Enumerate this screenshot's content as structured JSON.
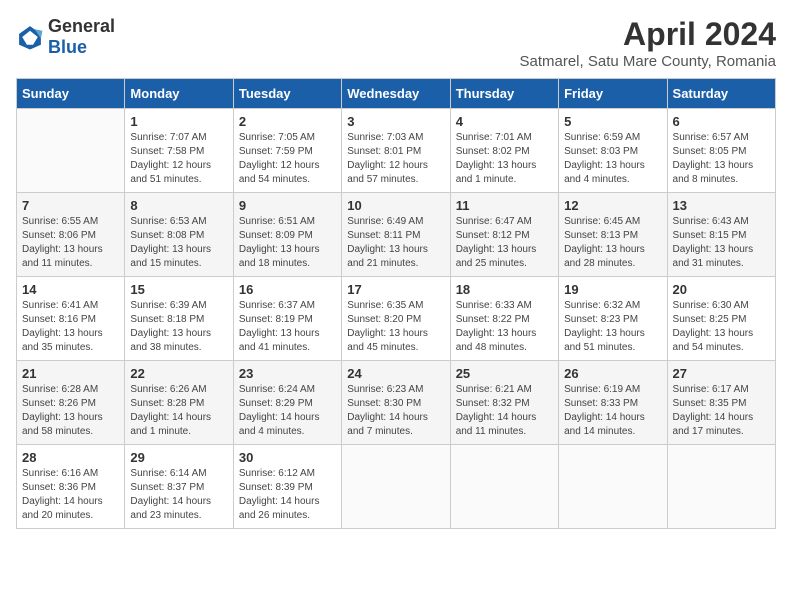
{
  "header": {
    "logo_general": "General",
    "logo_blue": "Blue",
    "month_title": "April 2024",
    "subtitle": "Satmarel, Satu Mare County, Romania"
  },
  "days_of_week": [
    "Sunday",
    "Monday",
    "Tuesday",
    "Wednesday",
    "Thursday",
    "Friday",
    "Saturday"
  ],
  "weeks": [
    [
      {
        "day": "",
        "sunrise": "",
        "sunset": "",
        "daylight": ""
      },
      {
        "day": "1",
        "sunrise": "Sunrise: 7:07 AM",
        "sunset": "Sunset: 7:58 PM",
        "daylight": "Daylight: 12 hours and 51 minutes."
      },
      {
        "day": "2",
        "sunrise": "Sunrise: 7:05 AM",
        "sunset": "Sunset: 7:59 PM",
        "daylight": "Daylight: 12 hours and 54 minutes."
      },
      {
        "day": "3",
        "sunrise": "Sunrise: 7:03 AM",
        "sunset": "Sunset: 8:01 PM",
        "daylight": "Daylight: 12 hours and 57 minutes."
      },
      {
        "day": "4",
        "sunrise": "Sunrise: 7:01 AM",
        "sunset": "Sunset: 8:02 PM",
        "daylight": "Daylight: 13 hours and 1 minute."
      },
      {
        "day": "5",
        "sunrise": "Sunrise: 6:59 AM",
        "sunset": "Sunset: 8:03 PM",
        "daylight": "Daylight: 13 hours and 4 minutes."
      },
      {
        "day": "6",
        "sunrise": "Sunrise: 6:57 AM",
        "sunset": "Sunset: 8:05 PM",
        "daylight": "Daylight: 13 hours and 8 minutes."
      }
    ],
    [
      {
        "day": "7",
        "sunrise": "Sunrise: 6:55 AM",
        "sunset": "Sunset: 8:06 PM",
        "daylight": "Daylight: 13 hours and 11 minutes."
      },
      {
        "day": "8",
        "sunrise": "Sunrise: 6:53 AM",
        "sunset": "Sunset: 8:08 PM",
        "daylight": "Daylight: 13 hours and 15 minutes."
      },
      {
        "day": "9",
        "sunrise": "Sunrise: 6:51 AM",
        "sunset": "Sunset: 8:09 PM",
        "daylight": "Daylight: 13 hours and 18 minutes."
      },
      {
        "day": "10",
        "sunrise": "Sunrise: 6:49 AM",
        "sunset": "Sunset: 8:11 PM",
        "daylight": "Daylight: 13 hours and 21 minutes."
      },
      {
        "day": "11",
        "sunrise": "Sunrise: 6:47 AM",
        "sunset": "Sunset: 8:12 PM",
        "daylight": "Daylight: 13 hours and 25 minutes."
      },
      {
        "day": "12",
        "sunrise": "Sunrise: 6:45 AM",
        "sunset": "Sunset: 8:13 PM",
        "daylight": "Daylight: 13 hours and 28 minutes."
      },
      {
        "day": "13",
        "sunrise": "Sunrise: 6:43 AM",
        "sunset": "Sunset: 8:15 PM",
        "daylight": "Daylight: 13 hours and 31 minutes."
      }
    ],
    [
      {
        "day": "14",
        "sunrise": "Sunrise: 6:41 AM",
        "sunset": "Sunset: 8:16 PM",
        "daylight": "Daylight: 13 hours and 35 minutes."
      },
      {
        "day": "15",
        "sunrise": "Sunrise: 6:39 AM",
        "sunset": "Sunset: 8:18 PM",
        "daylight": "Daylight: 13 hours and 38 minutes."
      },
      {
        "day": "16",
        "sunrise": "Sunrise: 6:37 AM",
        "sunset": "Sunset: 8:19 PM",
        "daylight": "Daylight: 13 hours and 41 minutes."
      },
      {
        "day": "17",
        "sunrise": "Sunrise: 6:35 AM",
        "sunset": "Sunset: 8:20 PM",
        "daylight": "Daylight: 13 hours and 45 minutes."
      },
      {
        "day": "18",
        "sunrise": "Sunrise: 6:33 AM",
        "sunset": "Sunset: 8:22 PM",
        "daylight": "Daylight: 13 hours and 48 minutes."
      },
      {
        "day": "19",
        "sunrise": "Sunrise: 6:32 AM",
        "sunset": "Sunset: 8:23 PM",
        "daylight": "Daylight: 13 hours and 51 minutes."
      },
      {
        "day": "20",
        "sunrise": "Sunrise: 6:30 AM",
        "sunset": "Sunset: 8:25 PM",
        "daylight": "Daylight: 13 hours and 54 minutes."
      }
    ],
    [
      {
        "day": "21",
        "sunrise": "Sunrise: 6:28 AM",
        "sunset": "Sunset: 8:26 PM",
        "daylight": "Daylight: 13 hours and 58 minutes."
      },
      {
        "day": "22",
        "sunrise": "Sunrise: 6:26 AM",
        "sunset": "Sunset: 8:28 PM",
        "daylight": "Daylight: 14 hours and 1 minute."
      },
      {
        "day": "23",
        "sunrise": "Sunrise: 6:24 AM",
        "sunset": "Sunset: 8:29 PM",
        "daylight": "Daylight: 14 hours and 4 minutes."
      },
      {
        "day": "24",
        "sunrise": "Sunrise: 6:23 AM",
        "sunset": "Sunset: 8:30 PM",
        "daylight": "Daylight: 14 hours and 7 minutes."
      },
      {
        "day": "25",
        "sunrise": "Sunrise: 6:21 AM",
        "sunset": "Sunset: 8:32 PM",
        "daylight": "Daylight: 14 hours and 11 minutes."
      },
      {
        "day": "26",
        "sunrise": "Sunrise: 6:19 AM",
        "sunset": "Sunset: 8:33 PM",
        "daylight": "Daylight: 14 hours and 14 minutes."
      },
      {
        "day": "27",
        "sunrise": "Sunrise: 6:17 AM",
        "sunset": "Sunset: 8:35 PM",
        "daylight": "Daylight: 14 hours and 17 minutes."
      }
    ],
    [
      {
        "day": "28",
        "sunrise": "Sunrise: 6:16 AM",
        "sunset": "Sunset: 8:36 PM",
        "daylight": "Daylight: 14 hours and 20 minutes."
      },
      {
        "day": "29",
        "sunrise": "Sunrise: 6:14 AM",
        "sunset": "Sunset: 8:37 PM",
        "daylight": "Daylight: 14 hours and 23 minutes."
      },
      {
        "day": "30",
        "sunrise": "Sunrise: 6:12 AM",
        "sunset": "Sunset: 8:39 PM",
        "daylight": "Daylight: 14 hours and 26 minutes."
      },
      {
        "day": "",
        "sunrise": "",
        "sunset": "",
        "daylight": ""
      },
      {
        "day": "",
        "sunrise": "",
        "sunset": "",
        "daylight": ""
      },
      {
        "day": "",
        "sunrise": "",
        "sunset": "",
        "daylight": ""
      },
      {
        "day": "",
        "sunrise": "",
        "sunset": "",
        "daylight": ""
      }
    ]
  ]
}
